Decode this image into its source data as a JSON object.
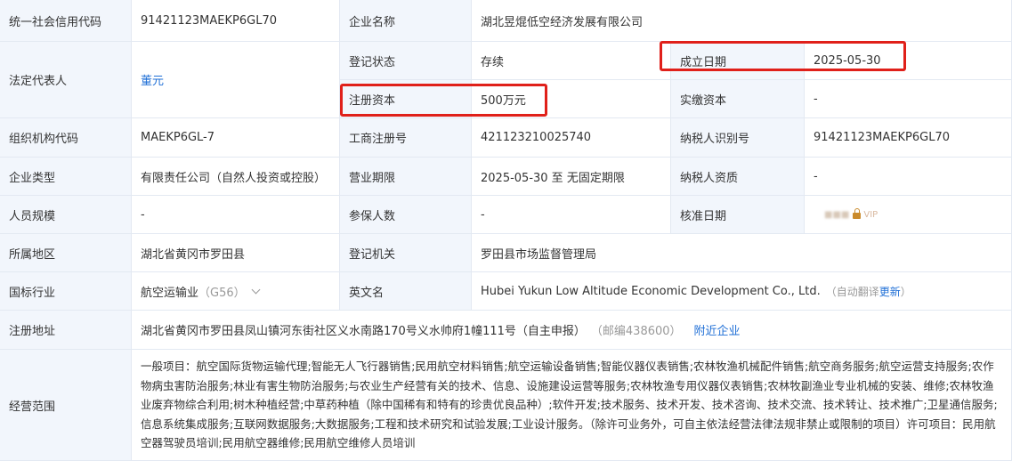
{
  "rows": {
    "credit_code": {
      "label": "统一社会信用代码",
      "value": "91421123MAEKP6GL70"
    },
    "company_name": {
      "label": "企业名称",
      "value": "湖北昱焜低空经济发展有限公司"
    },
    "legal_rep": {
      "label": "法定代表人",
      "value": "董元"
    },
    "reg_status": {
      "label": "登记状态",
      "value": "存续"
    },
    "established": {
      "label": "成立日期",
      "value": "2025-05-30"
    },
    "reg_capital": {
      "label": "注册资本",
      "value": "500万元"
    },
    "paid_capital": {
      "label": "实缴资本",
      "value": "-"
    },
    "org_code": {
      "label": "组织机构代码",
      "value": "MAEKP6GL-7"
    },
    "biz_reg_no": {
      "label": "工商注册号",
      "value": "421123210025740"
    },
    "taxpayer_id": {
      "label": "纳税人识别号",
      "value": "91421123MAEKP6GL70"
    },
    "company_type": {
      "label": "企业类型",
      "value": "有限责任公司（自然人投资或控股）"
    },
    "biz_term": {
      "label": "营业期限",
      "value": "2025-05-30 至 无固定期限"
    },
    "taxpayer_qual": {
      "label": "纳税人资质",
      "value": "-"
    },
    "staff_size": {
      "label": "人员规模",
      "value": "-"
    },
    "insured": {
      "label": "参保人数",
      "value": "-"
    },
    "approval_date": {
      "label": "核准日期",
      "value": "VIP"
    },
    "region": {
      "label": "所属地区",
      "value": "湖北省黄冈市罗田县"
    },
    "reg_authority": {
      "label": "登记机关",
      "value": "罗田县市场监督管理局"
    },
    "industry": {
      "label": "国标行业",
      "value": "航空运输业",
      "code": "（G56）"
    },
    "english_name": {
      "label": "英文名",
      "value": "Hubei Yukun Low Altitude Economic Development Co., Ltd.",
      "note": "（自动翻译",
      "action": "更新",
      "close": "）"
    },
    "address": {
      "label": "注册地址",
      "value": "湖北省黄冈市罗田县凤山镇河东街社区义水南路170号义水帅府1幢111号（自主申报）",
      "postcode": "（邮编438600）",
      "nearby": "附近企业"
    },
    "scope": {
      "label": "经营范围",
      "value": "一般项目：航空国际货物运输代理;智能无人飞行器销售;民用航空材料销售;航空运输设备销售;智能仪器仪表销售;农林牧渔机械配件销售;航空商务服务;航空运营支持服务;农作物病虫害防治服务;林业有害生物防治服务;与农业生产经营有关的技术、信息、设施建设运营等服务;农林牧渔专用仪器仪表销售;农林牧副渔业专业机械的安装、维修;农林牧渔业废弃物综合利用;树木种植经营;中草药种植（除中国稀有和特有的珍贵优良品种）;软件开发;技术服务、技术开发、技术咨询、技术交流、技术转让、技术推广;卫星通信服务;信息系统集成服务;互联网数据服务;大数据服务;工程和技术研究和试验发展;工业设计服务。（除许可业务外，可自主依法经营法律法规非禁止或限制的项目）许可项目：民用航空器驾驶员培训;民用航空器维修;民用航空维修人员培训"
    }
  },
  "colors": {
    "label_bg": "#f2f6fc",
    "border": "#e3e9f2",
    "link": "#1f6fd6",
    "highlight": "#e0201a"
  },
  "icons": {
    "lock": "lock-icon",
    "chevron": "chevron-down-icon"
  }
}
